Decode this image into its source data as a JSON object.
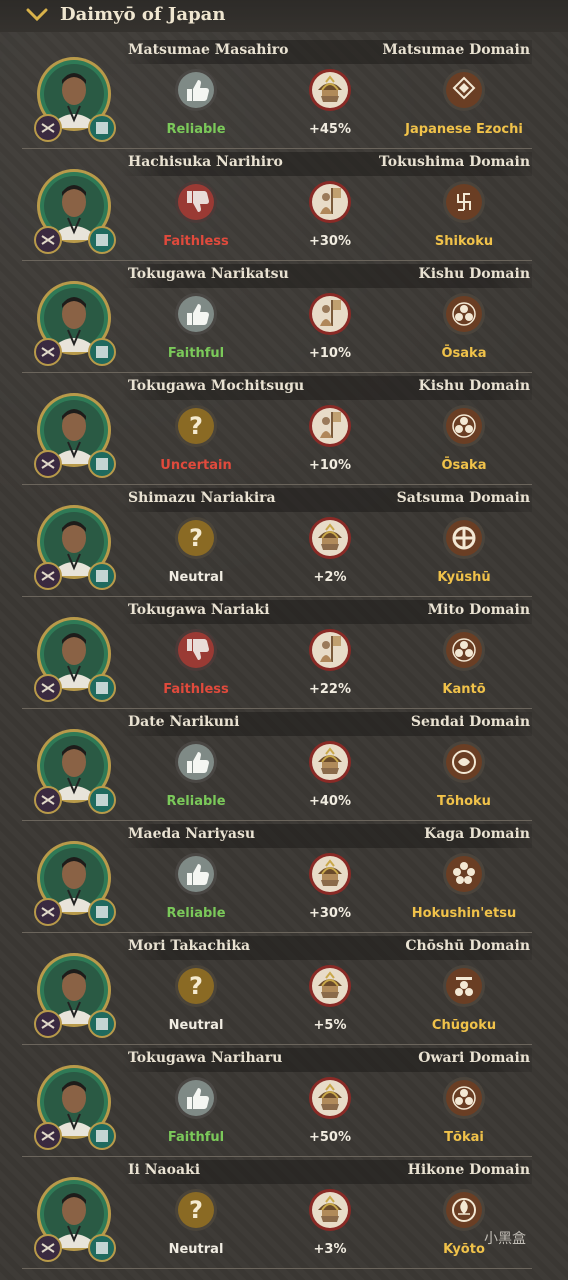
{
  "header": {
    "title": "Daimyō of Japan"
  },
  "colors": {
    "reliable": "#7bc95a",
    "faithless": "#e04a3c",
    "neutral": "#f0ece2",
    "region": "#f0c24a",
    "portrait_ring": "#2f7a56",
    "portrait_gold": "#b89a4a"
  },
  "rows": [
    {
      "name": "Matsumae Masahiro",
      "domain": "Matsumae Domain",
      "loyalty_icon": "thumbs-up-icon",
      "loyalty": "Reliable",
      "loyalty_color": "#7bc95a",
      "army_icon": "samurai-helmet-icon",
      "army": "+45%",
      "crest_icon": "matsumae-crest-icon",
      "region": "Japanese Ezochi"
    },
    {
      "name": "Hachisuka Narihiro",
      "domain": "Tokushima Domain",
      "loyalty_icon": "thumbs-down-icon",
      "loyalty": "Faithless",
      "loyalty_color": "#e04a3c",
      "army_icon": "banner-soldier-icon",
      "army": "+30%",
      "crest_icon": "manji-crest-icon",
      "region": "Shikoku"
    },
    {
      "name": "Tokugawa Narikatsu",
      "domain": "Kishu Domain",
      "loyalty_icon": "thumbs-up-icon",
      "loyalty": "Faithful",
      "loyalty_color": "#7bc95a",
      "army_icon": "banner-soldier-icon",
      "army": "+10%",
      "crest_icon": "hollyhock-crest-icon",
      "region": "Ōsaka"
    },
    {
      "name": "Tokugawa Mochitsugu",
      "domain": "Kishu Domain",
      "loyalty_icon": "question-icon",
      "loyalty": "Uncertain",
      "loyalty_color": "#e04a3c",
      "army_icon": "banner-soldier-icon",
      "army": "+10%",
      "crest_icon": "hollyhock-crest-icon",
      "region": "Ōsaka"
    },
    {
      "name": "Shimazu Nariakira",
      "domain": "Satsuma Domain",
      "loyalty_icon": "question-icon",
      "loyalty": "Neutral",
      "loyalty_color": "#f0ece2",
      "army_icon": "samurai-helmet-icon",
      "army": "+2%",
      "crest_icon": "cross-circle-crest-icon",
      "region": "Kyūshū"
    },
    {
      "name": "Tokugawa Nariaki",
      "domain": "Mito Domain",
      "loyalty_icon": "thumbs-down-icon",
      "loyalty": "Faithless",
      "loyalty_color": "#e04a3c",
      "army_icon": "banner-soldier-icon",
      "army": "+22%",
      "crest_icon": "hollyhock-crest-icon",
      "region": "Kantō"
    },
    {
      "name": "Date Narikuni",
      "domain": "Sendai Domain",
      "loyalty_icon": "thumbs-up-icon",
      "loyalty": "Reliable",
      "loyalty_color": "#7bc95a",
      "army_icon": "samurai-helmet-icon",
      "army": "+40%",
      "crest_icon": "bamboo-sparrow-crest-icon",
      "region": "Tōhoku"
    },
    {
      "name": "Maeda Nariyasu",
      "domain": "Kaga Domain",
      "loyalty_icon": "thumbs-up-icon",
      "loyalty": "Reliable",
      "loyalty_color": "#7bc95a",
      "army_icon": "samurai-helmet-icon",
      "army": "+30%",
      "crest_icon": "plum-blossom-crest-icon",
      "region": "Hokushin'etsu"
    },
    {
      "name": "Mori Takachika",
      "domain": "Chōshū Domain",
      "loyalty_icon": "question-icon",
      "loyalty": "Neutral",
      "loyalty_color": "#f0ece2",
      "army_icon": "samurai-helmet-icon",
      "army": "+5%",
      "crest_icon": "three-stars-crest-icon",
      "region": "Chūgoku"
    },
    {
      "name": "Tokugawa Nariharu",
      "domain": "Owari Domain",
      "loyalty_icon": "thumbs-up-icon",
      "loyalty": "Faithful",
      "loyalty_color": "#7bc95a",
      "army_icon": "samurai-helmet-icon",
      "army": "+50%",
      "crest_icon": "hollyhock-crest-icon",
      "region": "Tōkai"
    },
    {
      "name": "Ii Naoaki",
      "domain": "Hikone Domain",
      "loyalty_icon": "question-icon",
      "loyalty": "Neutral",
      "loyalty_color": "#f0ece2",
      "army_icon": "samurai-helmet-icon",
      "army": "+3%",
      "crest_icon": "tachibana-crest-icon",
      "region": "Kyōto"
    }
  ],
  "watermark": "小黑盒"
}
